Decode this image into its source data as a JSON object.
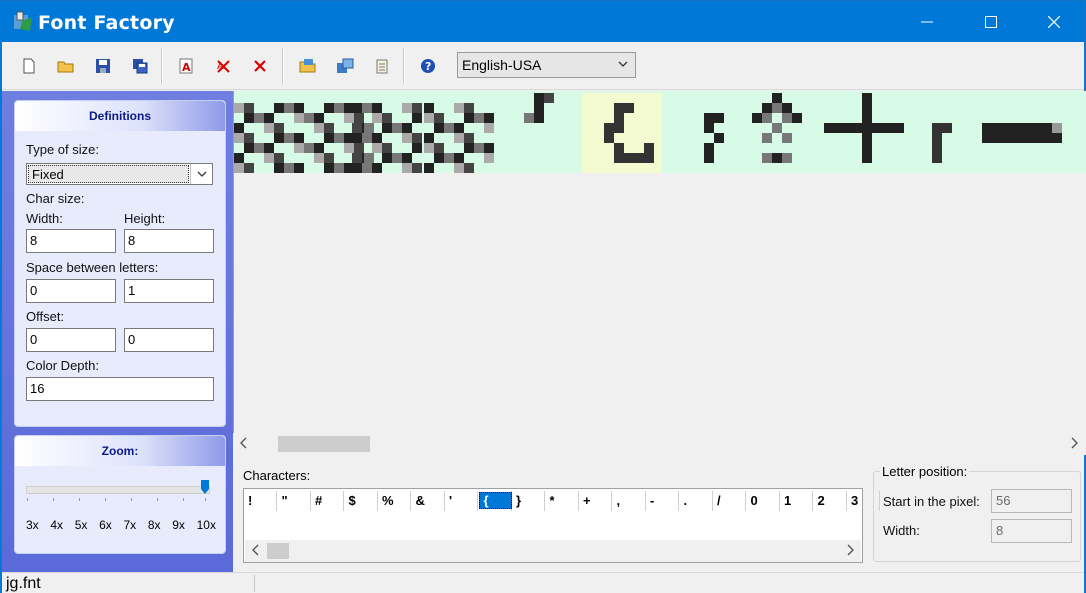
{
  "window": {
    "title": "Font Factory"
  },
  "toolbar": {
    "buttons": [
      "new-icon",
      "open-folder-icon",
      "save-icon",
      "save-all-icon",
      "font-edit-icon",
      "delete-red-icon",
      "close-red-icon",
      "open-image-icon",
      "export-icon",
      "clipboard-icon",
      "help-icon"
    ],
    "language": "English-USA"
  },
  "definitions": {
    "title": "Definitions",
    "type_of_size_label": "Type of size:",
    "type_of_size_value": "Fixed",
    "char_size_label": "Char size:",
    "width_label": "Width:",
    "height_label": "Height:",
    "width_value": "8",
    "height_value": "8",
    "space_label": "Space between letters:",
    "space_a": "0",
    "space_b": "1",
    "offset_label": "Offset:",
    "offset_a": "0",
    "offset_b": "0",
    "color_depth_label": "Color Depth:",
    "color_depth_value": "16"
  },
  "zoom": {
    "title": "Zoom:",
    "levels": [
      "3x",
      "4x",
      "5x",
      "6x",
      "7x",
      "8x",
      "9x",
      "10x"
    ],
    "selected": "10x"
  },
  "characters": {
    "label": "Characters:",
    "items": [
      "!",
      "\"",
      "#",
      "$",
      "%",
      "&",
      "'",
      "{",
      "}",
      "*",
      "+",
      ",",
      "-",
      ".",
      "/",
      "0",
      "1",
      "2",
      "3"
    ],
    "selected": "{"
  },
  "letter_position": {
    "title": "Letter position:",
    "start_label": "Start in the pixel:",
    "start_value": "56",
    "width_label": "Width:",
    "width_value": "8"
  },
  "status": {
    "file": "jg.fnt"
  },
  "colors": {
    "accent": "#0078d7",
    "canvas_bg": "#d8fbe8",
    "selected_char_bg": "#f4fbd0"
  }
}
